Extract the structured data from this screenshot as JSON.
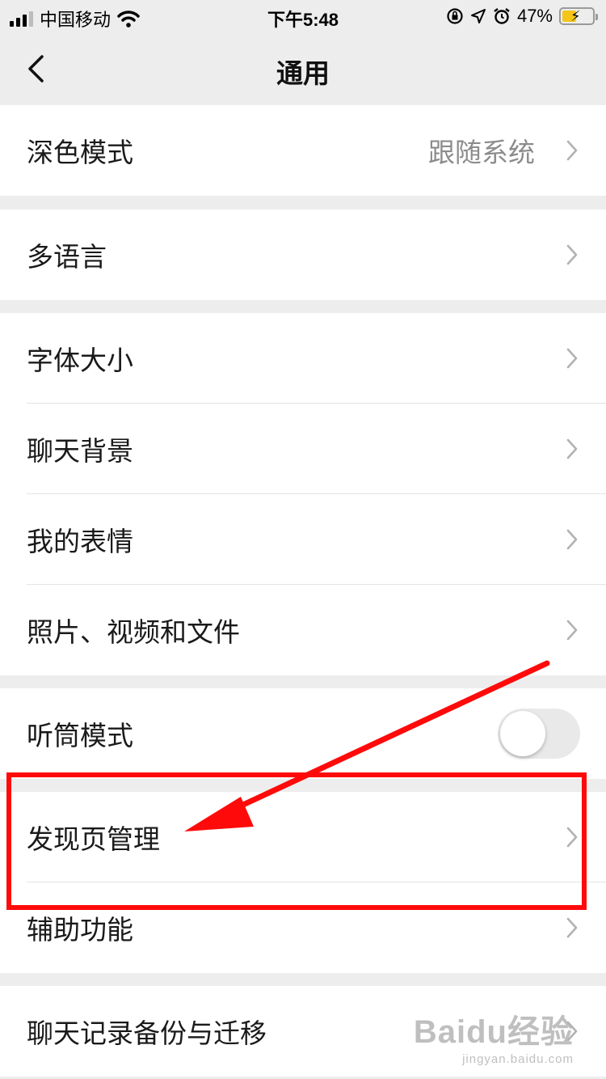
{
  "status_bar": {
    "carrier": "中国移动",
    "time": "下午5:48",
    "battery_percent": "47%",
    "battery_level": 0.47,
    "icons": [
      "signal-icon",
      "wifi-icon",
      "orientation-lock-icon",
      "location-icon",
      "alarm-icon",
      "battery-icon"
    ]
  },
  "nav": {
    "title": "通用",
    "back_icon": "chevron-left-icon"
  },
  "groups": {
    "g1": {
      "dark_mode": {
        "label": "深色模式",
        "value": "跟随系统"
      }
    },
    "g2": {
      "language": {
        "label": "多语言"
      }
    },
    "g3": {
      "font_size": {
        "label": "字体大小"
      },
      "chat_background": {
        "label": "聊天背景"
      },
      "my_stickers": {
        "label": "我的表情"
      },
      "media_files": {
        "label": "照片、视频和文件"
      }
    },
    "g4": {
      "earpiece_mode": {
        "label": "听筒模式",
        "enabled": false
      }
    },
    "g5": {
      "discover_manage": {
        "label": "发现页管理"
      },
      "accessibility": {
        "label": "辅助功能"
      }
    },
    "g6": {
      "chat_backup": {
        "label": "聊天记录备份与迁移"
      }
    }
  },
  "annotation": {
    "highlight_color": "#ff0a0a"
  },
  "watermark": {
    "main": "Baidu经验",
    "sub": "jingyan.baidu.com"
  },
  "colors": {
    "background": "#ededed",
    "cell": "#ffffff",
    "secondary_text": "#8c8c8c",
    "battery": "#f5c518"
  }
}
